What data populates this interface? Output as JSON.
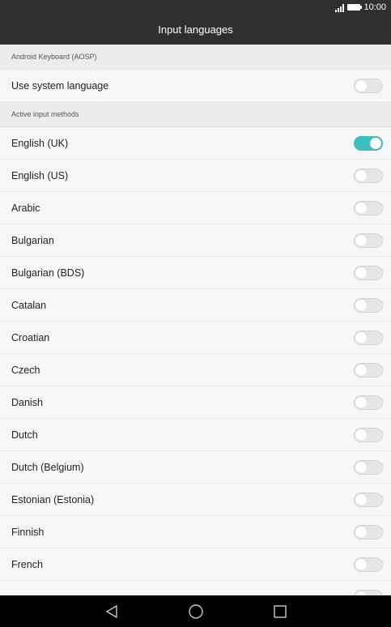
{
  "status": {
    "time": "10:00"
  },
  "appbar": {
    "title": "Input languages"
  },
  "sections": [
    {
      "header": "Android Keyboard (AOSP)",
      "rows": [
        {
          "label": "Use system language",
          "on": false
        }
      ]
    },
    {
      "header": "Active input methods",
      "rows": [
        {
          "label": "English (UK)",
          "on": true
        },
        {
          "label": "English (US)",
          "on": false
        },
        {
          "label": "Arabic",
          "on": false
        },
        {
          "label": "Bulgarian",
          "on": false
        },
        {
          "label": "Bulgarian (BDS)",
          "on": false
        },
        {
          "label": "Catalan",
          "on": false
        },
        {
          "label": "Croatian",
          "on": false
        },
        {
          "label": "Czech",
          "on": false
        },
        {
          "label": "Danish",
          "on": false
        },
        {
          "label": "Dutch",
          "on": false
        },
        {
          "label": "Dutch (Belgium)",
          "on": false
        },
        {
          "label": "Estonian (Estonia)",
          "on": false
        },
        {
          "label": "Finnish",
          "on": false
        },
        {
          "label": "French",
          "on": false
        },
        {
          "label": "",
          "on": false
        }
      ]
    }
  ],
  "colors": {
    "accent": "#3cbfc0",
    "bar": "#2d2f31",
    "nav": "#000000"
  },
  "navbar": {
    "icons": [
      "back-icon",
      "home-icon",
      "recents-icon"
    ]
  }
}
